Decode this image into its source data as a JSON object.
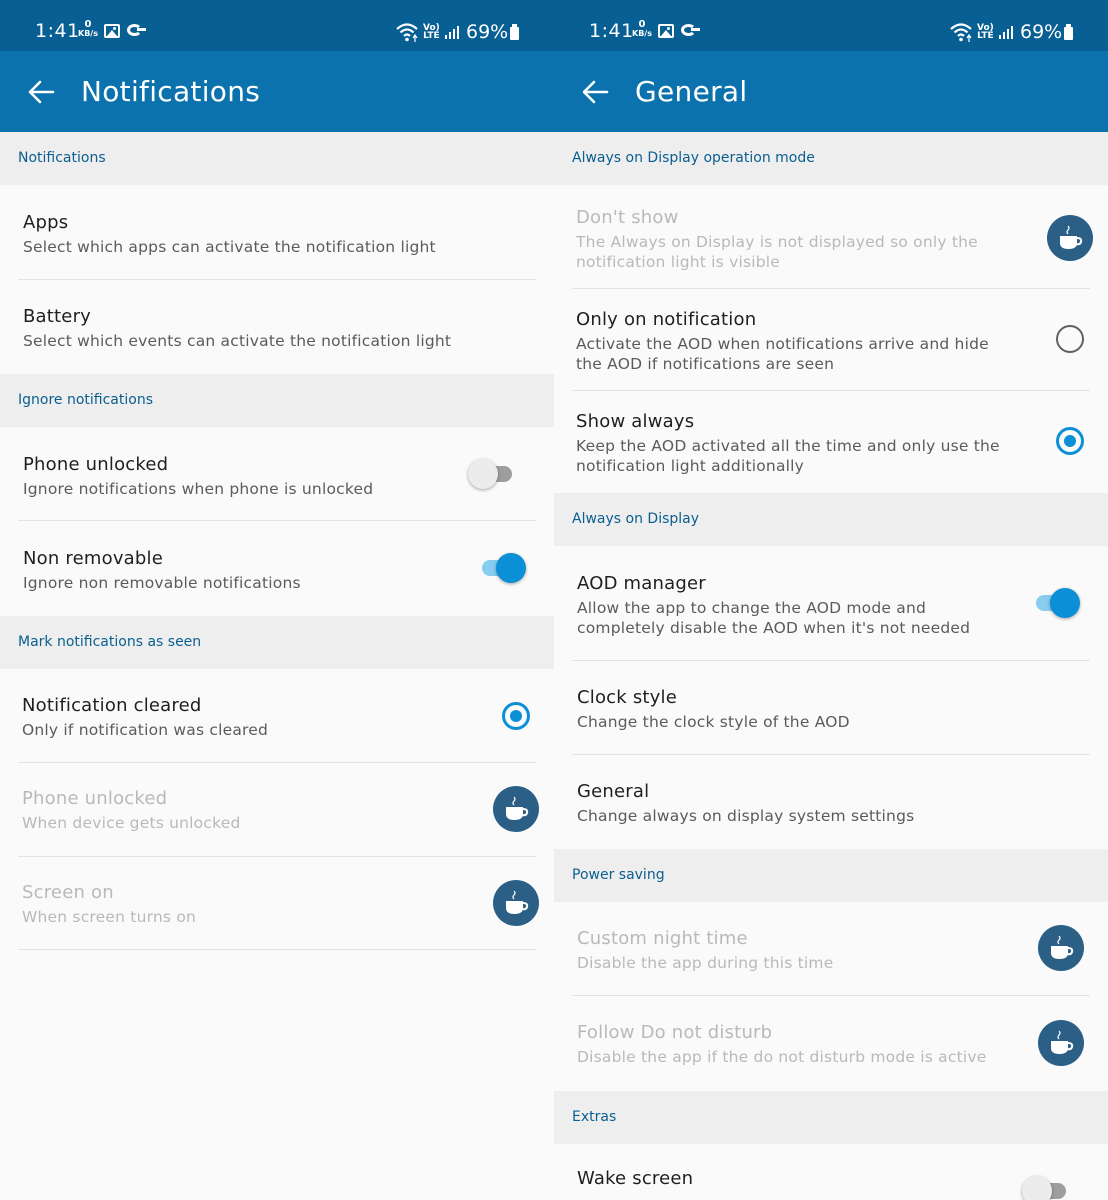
{
  "colors": {
    "status_bar": "#085f93",
    "app_bar": "#0b72ad",
    "accent": "#0b8fd6",
    "category_text": "#0a5f90",
    "pro_badge": "#2b5f86"
  },
  "status": {
    "time": "1:41",
    "net_speed_value": "0",
    "net_speed_unit": "KB/s",
    "volte_top": "Vo)",
    "volte_bottom": "LTE",
    "battery": "69%"
  },
  "left": {
    "title": "Notifications",
    "sections": [
      {
        "header": "Notifications"
      },
      {
        "header": "Ignore notifications"
      },
      {
        "header": "Mark notifications as seen"
      }
    ],
    "items": [
      {
        "title": "Apps",
        "summary": "Select which apps can activate the notification light"
      },
      {
        "title": "Battery",
        "summary": "Select which events can activate the notification light"
      },
      {
        "title": "Phone unlocked",
        "summary": "Ignore notifications when phone is unlocked",
        "toggle": false
      },
      {
        "title": "Non removable",
        "summary": "Ignore non removable notifications",
        "toggle": true
      },
      {
        "title": "Notification cleared",
        "summary": "Only if notification was cleared",
        "radio": true
      },
      {
        "title": "Phone unlocked",
        "summary": "When device gets unlocked",
        "pro_icon": "coffee-cup-icon",
        "disabled": true
      },
      {
        "title": "Screen on",
        "summary": "When screen turns on",
        "pro_icon": "coffee-cup-icon",
        "disabled": true
      }
    ]
  },
  "right": {
    "title": "General",
    "sections": [
      {
        "header": "Always on Display operation mode"
      },
      {
        "header": "Always on Display"
      },
      {
        "header": "Power saving"
      },
      {
        "header": "Extras"
      }
    ],
    "items": [
      {
        "title": "Don't show",
        "summary": "The Always on Display is not displayed so only the notification light is visible",
        "pro_icon": "coffee-cup-icon",
        "disabled": true
      },
      {
        "title": "Only on notification",
        "summary": "Activate the AOD when notifications arrive and hide the AOD if notifications are seen",
        "radio": false
      },
      {
        "title": "Show always",
        "summary": "Keep the AOD activated all the time and only use the notification light additionally",
        "radio": true
      },
      {
        "title": "AOD manager",
        "summary": "Allow the app to change the AOD mode and completely disable the AOD when it's not needed",
        "toggle": true
      },
      {
        "title": "Clock style",
        "summary": "Change the clock style of the AOD"
      },
      {
        "title": "General",
        "summary": "Change always on display system settings"
      },
      {
        "title": "Custom night time",
        "summary": "Disable the app during this time",
        "pro_icon": "coffee-cup-icon",
        "disabled": true
      },
      {
        "title": "Follow Do not disturb",
        "summary": "Disable the app if the do not disturb mode is active",
        "pro_icon": "coffee-cup-icon",
        "disabled": true
      },
      {
        "title": "Wake screen",
        "toggle": false
      }
    ]
  }
}
